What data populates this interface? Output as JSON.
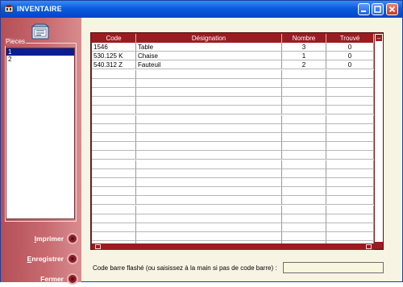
{
  "window": {
    "title": "INVENTAIRE"
  },
  "sidebar": {
    "box_icon_text": "|ABCD| FR",
    "pieces_legend": "Pieces",
    "pieces": [
      "1",
      "2"
    ],
    "selected_index": 0,
    "buttons": {
      "print": {
        "accel": "I",
        "rest": "mprimer"
      },
      "save": {
        "accel": "E",
        "rest": "nregistrer"
      },
      "close": {
        "accel": "F",
        "rest": "ermer"
      }
    }
  },
  "grid": {
    "columns": [
      "Code",
      "Désignation",
      "Nombre",
      "Trouvé"
    ],
    "rows": [
      {
        "code": "1546",
        "designation": "Table",
        "nombre": "3",
        "trouve": "0"
      },
      {
        "code": "530.125 K",
        "designation": "Chaise",
        "nombre": "1",
        "trouve": "0"
      },
      {
        "code": "540.312 Z",
        "designation": "Fauteuil",
        "nombre": "2",
        "trouve": "0"
      }
    ],
    "empty_rows": 20,
    "scroll_up_glyph": "–"
  },
  "barcode": {
    "label": "Code barre flashé (ou saisissez à la main si pas de code barre) :",
    "value": ""
  },
  "colors": {
    "titlebar": "#0a5bde",
    "panel": "#c25f66",
    "grid_header": "#9a1c21",
    "selection": "#0a1f8f"
  }
}
